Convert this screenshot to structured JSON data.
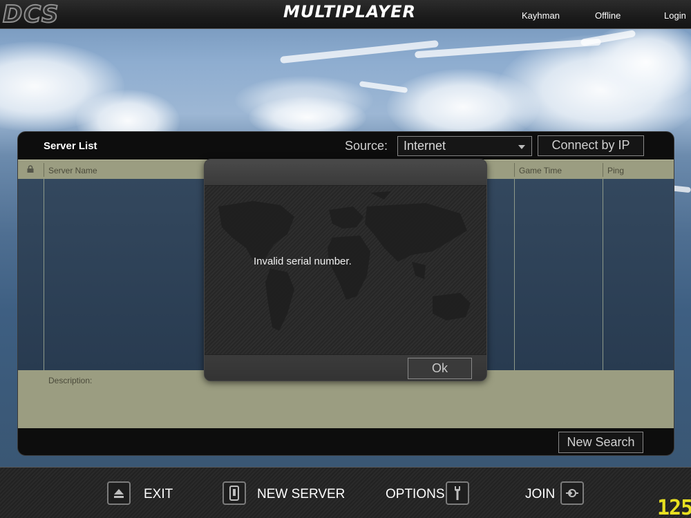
{
  "topbar": {
    "logo": "DCS",
    "title": "MULTIPLAYER",
    "username": "Kayhman",
    "status": "Offline",
    "login": "Login"
  },
  "server_list": {
    "title": "Server List",
    "source_label": "Source:",
    "source_value": "Internet",
    "connect_by_ip": "Connect by IP",
    "columns": {
      "lock": "lock-icon",
      "server_name": "Server Name",
      "game_time": "Game Time",
      "ping": "Ping"
    },
    "description_label": "Description:",
    "new_search": "New Search"
  },
  "dialog": {
    "message": "Invalid serial number.",
    "ok": "Ok"
  },
  "bottom_bar": {
    "exit": "EXIT",
    "new_server": "NEW SERVER",
    "options": "OPTIONS",
    "join": "JOIN"
  },
  "fps": "125",
  "colors": {
    "table_header": "#9b9d81",
    "fps_counter": "#e8e021"
  }
}
